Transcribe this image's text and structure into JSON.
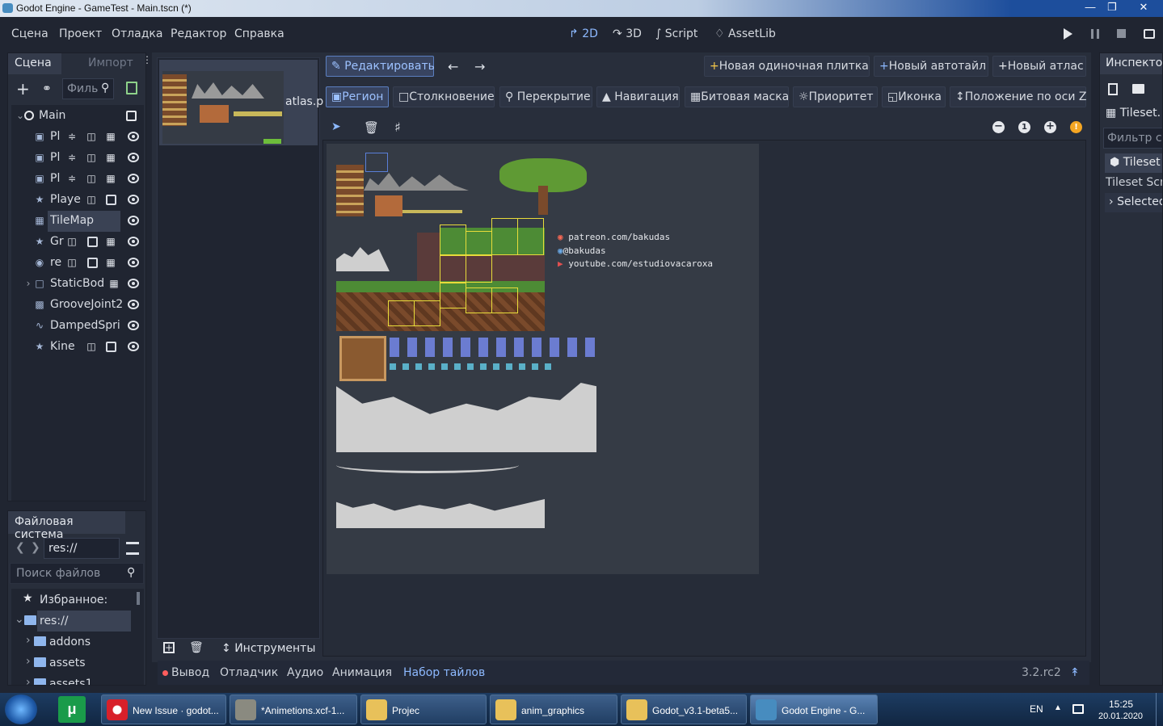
{
  "window": {
    "title": "Godot Engine - GameTest - Main.tscn (*)"
  },
  "menu": [
    "Сцена",
    "Проект",
    "Отладка",
    "Редактор",
    "Справка"
  ],
  "modes": {
    "d2": "2D",
    "d3": "3D",
    "script": "Script",
    "assetlib": "AssetLib"
  },
  "scene_dock": {
    "tab_scene": "Сцена",
    "tab_import": "Импорт",
    "filter_placeholder": "Филь",
    "nodes": [
      {
        "label": "Main",
        "icon": "node-icon"
      },
      {
        "label": "Pl",
        "icon": "particles-icon"
      },
      {
        "label": "Pl",
        "icon": "particles-icon"
      },
      {
        "label": "Pl",
        "icon": "particles-icon"
      },
      {
        "label": "Playe",
        "icon": "kinematic-icon"
      },
      {
        "label": "TileMap",
        "icon": "tilemap-icon"
      },
      {
        "label": "Gr",
        "icon": "kinematic-icon"
      },
      {
        "label": "re",
        "icon": "globe-icon"
      },
      {
        "label": "StaticBod",
        "icon": "staticbody-icon"
      },
      {
        "label": "GrooveJoint2",
        "icon": "groove-icon"
      },
      {
        "label": "DampedSpri",
        "icon": "spring-icon"
      },
      {
        "label": "Kine",
        "icon": "kinematic-icon"
      }
    ]
  },
  "fs_dock": {
    "title": "Файловая система",
    "path": "res://",
    "search_placeholder": "Поиск файлов",
    "favorites": "Избранное:",
    "root": "res://",
    "folders": [
      "addons",
      "assets",
      "assets1"
    ]
  },
  "tileset": {
    "atlas_label": "atlas.p",
    "edit_button": "Редактировать",
    "new_single_tile": "Новая одиночная плитка",
    "new_autotile": "Новый автотайл",
    "new_atlas": "Новый атлас",
    "modes": [
      "Регион",
      "Столкновение",
      "Перекрытие",
      "Навигация",
      "Битовая маска",
      "Приоритет",
      "Иконка",
      "Положение по оси Z"
    ],
    "tools_label": "Инструменты",
    "credits": [
      "patreon.com/bakudas",
      "@bakudas",
      "youtube.com/estudiovacaroxa"
    ]
  },
  "inspector": {
    "title": "Инспектор",
    "file": "Tileset.",
    "filter_placeholder": "Фильтр св",
    "resource": "Tileset",
    "script_label": "Tileset Scri",
    "selected": "Selected"
  },
  "bottom_panel": {
    "tabs": [
      "Вывод",
      "Отладчик",
      "Аудио",
      "Анимация",
      "Набор тайлов"
    ],
    "version": "3.2.rc2"
  },
  "taskbar": {
    "tasks": [
      "New Issue · godot...",
      "*Animetions.xcf-1...",
      "Projec",
      "anim_graphics",
      "Godot_v3.1-beta5...",
      "Godot Engine - G..."
    ],
    "lang": "EN",
    "time": "15:25",
    "date": "20.01.2020"
  },
  "colors": {
    "accent": "#8db9ff",
    "selection_yellow": "#e8dc3a",
    "bg": "#202531"
  }
}
